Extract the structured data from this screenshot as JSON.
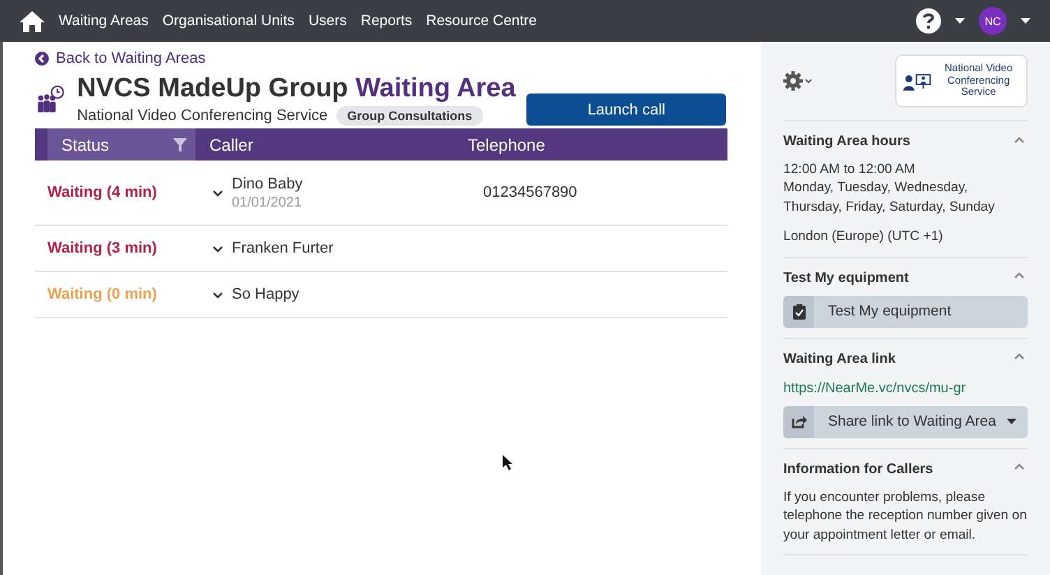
{
  "nav": {
    "items": [
      "Waiting Areas",
      "Organisational Units",
      "Users",
      "Reports",
      "Resource Centre"
    ],
    "avatar": "NC"
  },
  "back_link": "Back to Waiting Areas",
  "header": {
    "title": "NVCS MadeUp Group",
    "title_accent": "Waiting Area",
    "subtitle": "National Video Conferencing Service",
    "tag": "Group Consultations"
  },
  "launch_button": "Launch call",
  "table": {
    "columns": [
      "Status",
      "Caller",
      "Telephone"
    ],
    "rows": [
      {
        "status": "Waiting (4 min)",
        "color": "#b3204a",
        "caller": "Dino Baby",
        "dob": "01/01/2021",
        "telephone": "01234567890"
      },
      {
        "status": "Waiting (3 min)",
        "color": "#b3204a",
        "caller": "Franken Furter"
      },
      {
        "status": "Waiting (0 min)",
        "color": "#e9a352",
        "caller": "So Happy"
      }
    ]
  },
  "sidebar": {
    "logo_text": "National Video Conferencing Service",
    "sections": [
      {
        "title": "Waiting Area hours",
        "expanded": true,
        "kind": "text",
        "lines": [
          "12:00 AM to 12:00 AM\nMonday, Tuesday, Wednesday, Thursday, Friday, Saturday, Sunday",
          "London (Europe) (UTC +1)"
        ]
      },
      {
        "title": "Test My equipment",
        "expanded": true,
        "kind": "button",
        "button": "Test My equipment"
      },
      {
        "title": "Waiting Area link",
        "expanded": true,
        "kind": "link",
        "link": "https://NearMe.vc/nvcs/mu-gr",
        "button": "Share link to Waiting Area"
      },
      {
        "title": "Information for Callers",
        "expanded": true,
        "kind": "text",
        "lines": [
          "If you encounter problems, please telephone the reception number given on your appointment letter or email."
        ]
      }
    ]
  }
}
